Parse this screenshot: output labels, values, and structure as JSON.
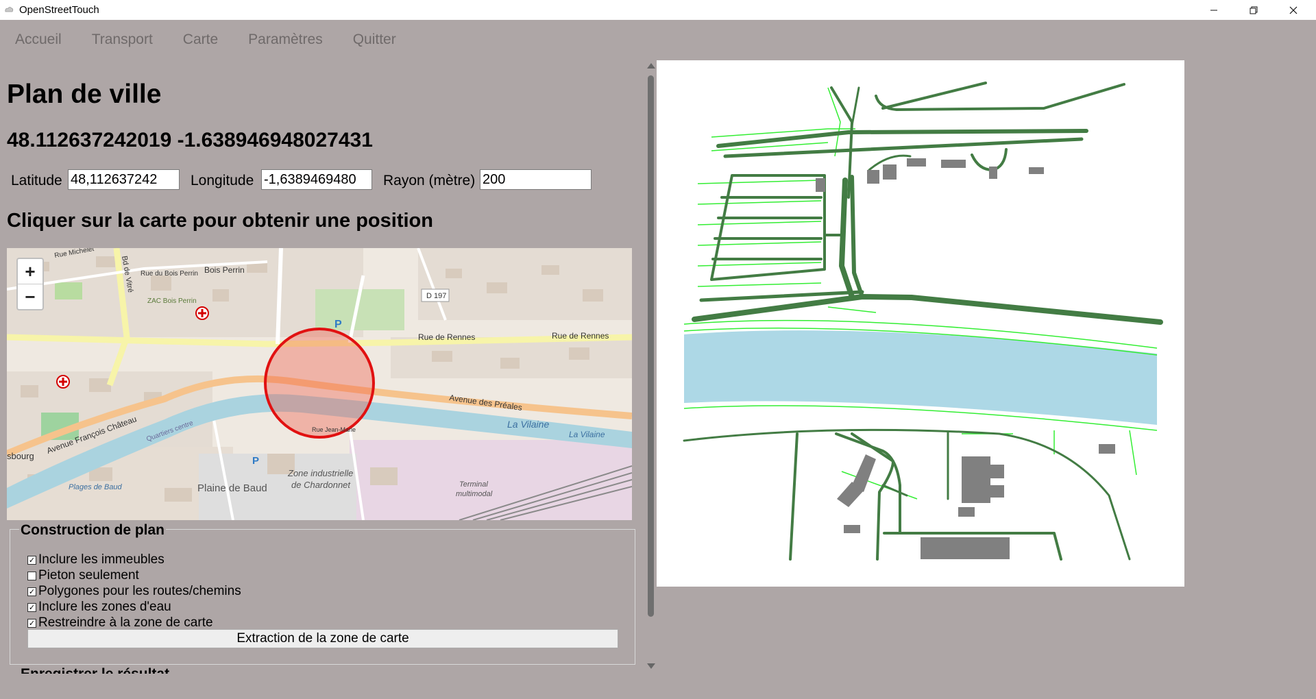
{
  "window": {
    "title": "OpenStreetTouch"
  },
  "menu": {
    "items": [
      "Accueil",
      "Transport",
      "Carte",
      "Paramètres",
      "Quitter"
    ]
  },
  "page": {
    "title": "Plan de ville",
    "coords": "48.112637242019 -1.638946948027431",
    "instruction": "Cliquer sur la carte pour obtenir une position"
  },
  "fields": {
    "latitude_label": "Latitude",
    "latitude_value": "48,112637242",
    "longitude_label": "Longitude",
    "longitude_value": "-1,6389469480",
    "radius_label": "Rayon (mètre)",
    "radius_value": "200"
  },
  "map": {
    "zoom_in": "+",
    "zoom_out": "−",
    "labels": {
      "rue_michelet": "Rue Michelet",
      "rue_bois_perrin": "Rue du Bois Perrin",
      "bois_perrin": "Bois Perrin",
      "bd_vitre": "Bd de Vitré",
      "zac_bois_perrin": "ZAC Bois Perrin",
      "d197": "D 197",
      "rue_de_rennes_1": "Rue de Rennes",
      "rue_de_rennes_2": "Rue de Rennes",
      "avenue_preales": "Avenue des Préales",
      "la_vilaine_1": "La Vilaine",
      "la_vilaine_2": "La Vilaine",
      "avenue_chateau": "Avenue François Château",
      "quartiers_centre": "Quartiers centre",
      "bourg": "sbourg",
      "plages_baud": "Plages de Baud",
      "plaine_de_baud": "Plaine de Baud",
      "zone_industrielle": "Zone industrielle",
      "de_chardonnet": "de Chardonnet",
      "terminal": "Terminal",
      "multimodal": "multimodal",
      "rue_jean_marie": "Rue Jean-Marie",
      "parking": "P"
    }
  },
  "options": {
    "group_title": "Construction de plan",
    "items": [
      {
        "label": "Inclure les immeubles",
        "checked": true
      },
      {
        "label": "Pieton seulement",
        "checked": false
      },
      {
        "label": "Polygones pour les routes/chemins",
        "checked": true
      },
      {
        "label": "Inclure les zones d'eau",
        "checked": true
      },
      {
        "label": "Restreindre à la zone de carte",
        "checked": true
      }
    ],
    "extract_button": "Extraction de la zone de carte",
    "next_section_partial": "Enregistrer le résultat"
  },
  "colors": {
    "background": "#aea6a6",
    "road": "#437c44",
    "path": "#33ee33",
    "water": "#add8e6",
    "building": "#808080",
    "circle": "#e11111"
  }
}
